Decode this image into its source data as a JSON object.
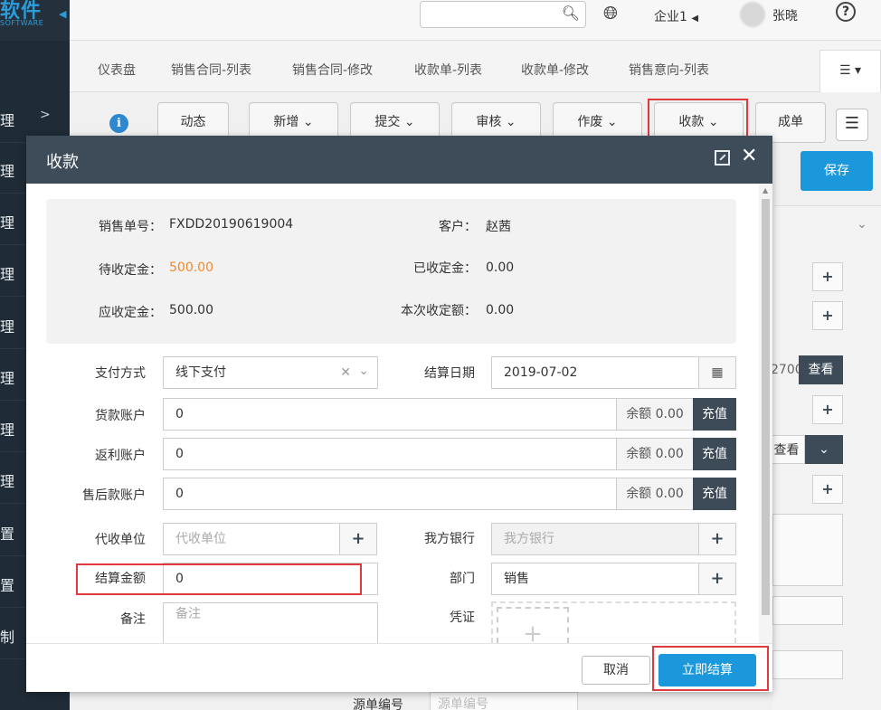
{
  "sidebar": {
    "brand": "软件",
    "brand_sub": "SOFTWARE",
    "items": [
      {
        "label": "理"
      },
      {
        "label": "理"
      },
      {
        "label": "理"
      },
      {
        "label": "理"
      },
      {
        "label": "理"
      },
      {
        "label": "理"
      },
      {
        "label": "理"
      },
      {
        "label": "理"
      },
      {
        "label": "置"
      },
      {
        "label": "置"
      },
      {
        "label": "制"
      }
    ]
  },
  "topbar": {
    "search_placeholder": "",
    "company": "企业1",
    "username": "张晓",
    "help": "?"
  },
  "tabs": [
    "仪表盘",
    "销售合同-列表",
    "销售合同-修改",
    "收款单-列表",
    "收款单-修改",
    "销售意向-列表"
  ],
  "toolbar": {
    "info": "i",
    "buttons": [
      {
        "label": "动态"
      },
      {
        "label": "新增"
      },
      {
        "label": "提交"
      },
      {
        "label": "审核"
      },
      {
        "label": "作废"
      },
      {
        "label": "收款"
      },
      {
        "label": "成单"
      }
    ]
  },
  "background": {
    "save": "保存",
    "view1": "查看",
    "view2": "查看",
    "partial_value": "2700",
    "source_no_label": "源单编号",
    "source_no_placeholder": "源单编号"
  },
  "modal": {
    "title": "收款",
    "summary": {
      "order_no_label": "销售单号：",
      "order_no": "FXDD20190619004",
      "customer_label": "客户：",
      "customer": "赵茜",
      "pending_label": "待收定金：",
      "pending": "500.00",
      "received_label": "已收定金：",
      "received": "0.00",
      "due_label": "应收定金：",
      "due": "500.00",
      "current_label": "本次收定额：",
      "current": "0.00"
    },
    "form": {
      "pay_method_label": "支付方式",
      "pay_method": "线下支付",
      "settle_date_label": "结算日期",
      "settle_date": "2019-07-02",
      "goods_account_label": "货款账户",
      "goods_account": "0",
      "rebate_account_label": "返利账户",
      "rebate_account": "0",
      "aftersale_account_label": "售后款账户",
      "aftersale_account": "0",
      "balance": "余额 0.00",
      "charge": "充值",
      "collector_label": "代收单位",
      "collector_placeholder": "代收单位",
      "our_bank_label": "我方银行",
      "our_bank_placeholder": "我方银行",
      "amount_label": "结算金额",
      "amount": "0",
      "dept_label": "部门",
      "dept": "销售",
      "remark_label": "备注",
      "remark_placeholder": "备注",
      "voucher_label": "凭证"
    },
    "cancel": "取消",
    "settle": "立即结算"
  },
  "colors": {
    "accent": "#1a98db",
    "dark": "#3e4c5a",
    "highlight": "#e0393e",
    "orange": "#f08a2c"
  }
}
